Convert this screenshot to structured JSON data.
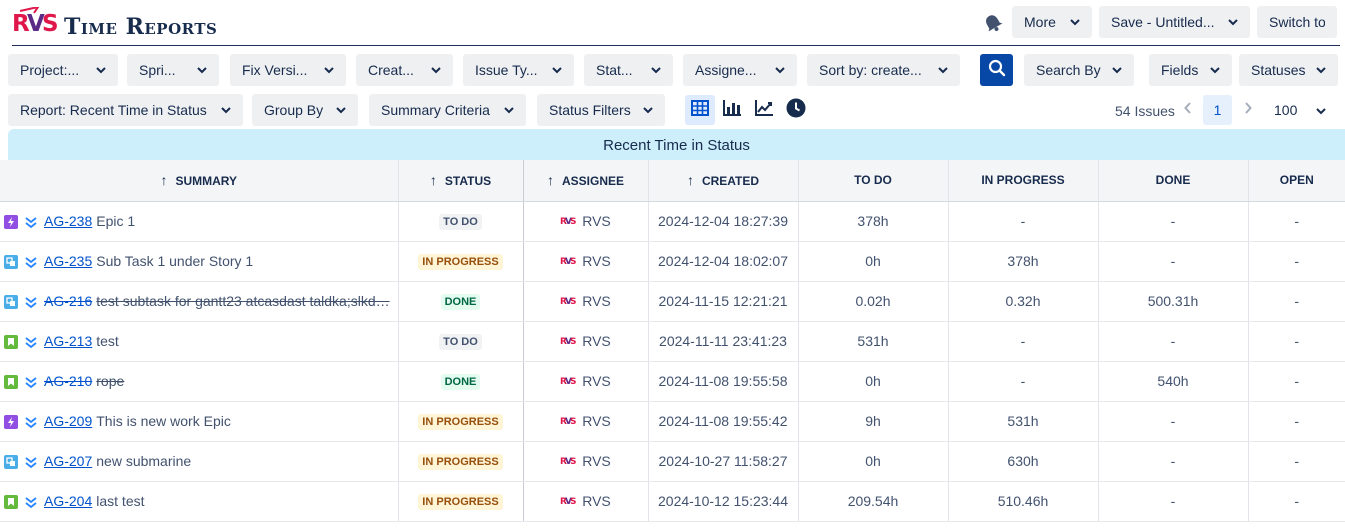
{
  "app": {
    "title": "Time Reports"
  },
  "header": {
    "more_label": "More",
    "save_label": "Save - Untitled...",
    "switch_label": "Switch to"
  },
  "filters": {
    "project": "Project:...",
    "sprint": "Spri...",
    "fix_version": "Fix Versi...",
    "created": "Creat...",
    "issue_type": "Issue Ty...",
    "status": "Stat...",
    "assignee": "Assigne...",
    "sort_by": "Sort by: create...",
    "search_by": "Search By",
    "fields": "Fields",
    "statuses": "Statuses"
  },
  "toolbar2": {
    "report": "Report: Recent Time in Status",
    "group_by": "Group By",
    "summary_criteria": "Summary Criteria",
    "status_filters": "Status Filters"
  },
  "pagination": {
    "issues_count": "54 Issues",
    "current_page": "1",
    "page_size": "100"
  },
  "report_title": "Recent Time in Status",
  "table": {
    "headers": {
      "summary": "Summary",
      "status": "Status",
      "assignee": "Assignee",
      "created": "Created",
      "todo": "To Do",
      "in_progress": "In Progress",
      "done": "Done",
      "open": "Open"
    },
    "rows": [
      {
        "type": "epic",
        "key": "AG-238",
        "title": "Epic 1",
        "status": "TO DO",
        "assignee": "RVS",
        "created": "2024-12-04 18:27:39",
        "todo": "378h",
        "in_progress": "-",
        "done": "-",
        "open": "-"
      },
      {
        "type": "subtask",
        "key": "AG-235",
        "title": "Sub Task 1 under Story 1",
        "status": "IN PROGRESS",
        "assignee": "RVS",
        "created": "2024-12-04 18:02:07",
        "todo": "0h",
        "in_progress": "378h",
        "done": "-",
        "open": "-"
      },
      {
        "type": "subtask",
        "key": "AG-216",
        "title": "test subtask for gantt23 atcasdast taldka;slkd…",
        "status": "DONE",
        "assignee": "RVS",
        "created": "2024-11-15 12:21:21",
        "todo": "0.02h",
        "in_progress": "0.32h",
        "done": "500.31h",
        "open": "-"
      },
      {
        "type": "story",
        "key": "AG-213",
        "title": "test",
        "status": "TO DO",
        "assignee": "RVS",
        "created": "2024-11-11 23:41:23",
        "todo": "531h",
        "in_progress": "-",
        "done": "-",
        "open": "-"
      },
      {
        "type": "story",
        "key": "AG-210",
        "title": "rope",
        "status": "DONE",
        "assignee": "RVS",
        "created": "2024-11-08 19:55:58",
        "todo": "0h",
        "in_progress": "-",
        "done": "540h",
        "open": "-"
      },
      {
        "type": "epic",
        "key": "AG-209",
        "title": "This is new work Epic",
        "status": "IN PROGRESS",
        "assignee": "RVS",
        "created": "2024-11-08 19:55:42",
        "todo": "9h",
        "in_progress": "531h",
        "done": "-",
        "open": "-"
      },
      {
        "type": "subtask",
        "key": "AG-207",
        "title": "new submarine",
        "status": "IN PROGRESS",
        "assignee": "RVS",
        "created": "2024-10-27 11:58:27",
        "todo": "0h",
        "in_progress": "630h",
        "done": "-",
        "open": "-"
      },
      {
        "type": "story",
        "key": "AG-204",
        "title": "last test",
        "status": "IN PROGRESS",
        "assignee": "RVS",
        "created": "2024-10-12 15:23:44",
        "todo": "209.54h",
        "in_progress": "510.46h",
        "done": "-",
        "open": "-"
      }
    ]
  },
  "colors": {
    "primary": "#0747a6",
    "link": "#0052cc",
    "banner": "#cdeefb",
    "button_bg": "#eff0f2",
    "logo_red": "#e0174a",
    "logo_purple": "#5b2a86"
  },
  "icons": {
    "bell": "bell-icon",
    "search": "search-icon",
    "table_view": "table-view-icon",
    "bar_chart": "bar-chart-icon",
    "line_chart": "line-chart-icon",
    "clock": "clock-icon"
  }
}
